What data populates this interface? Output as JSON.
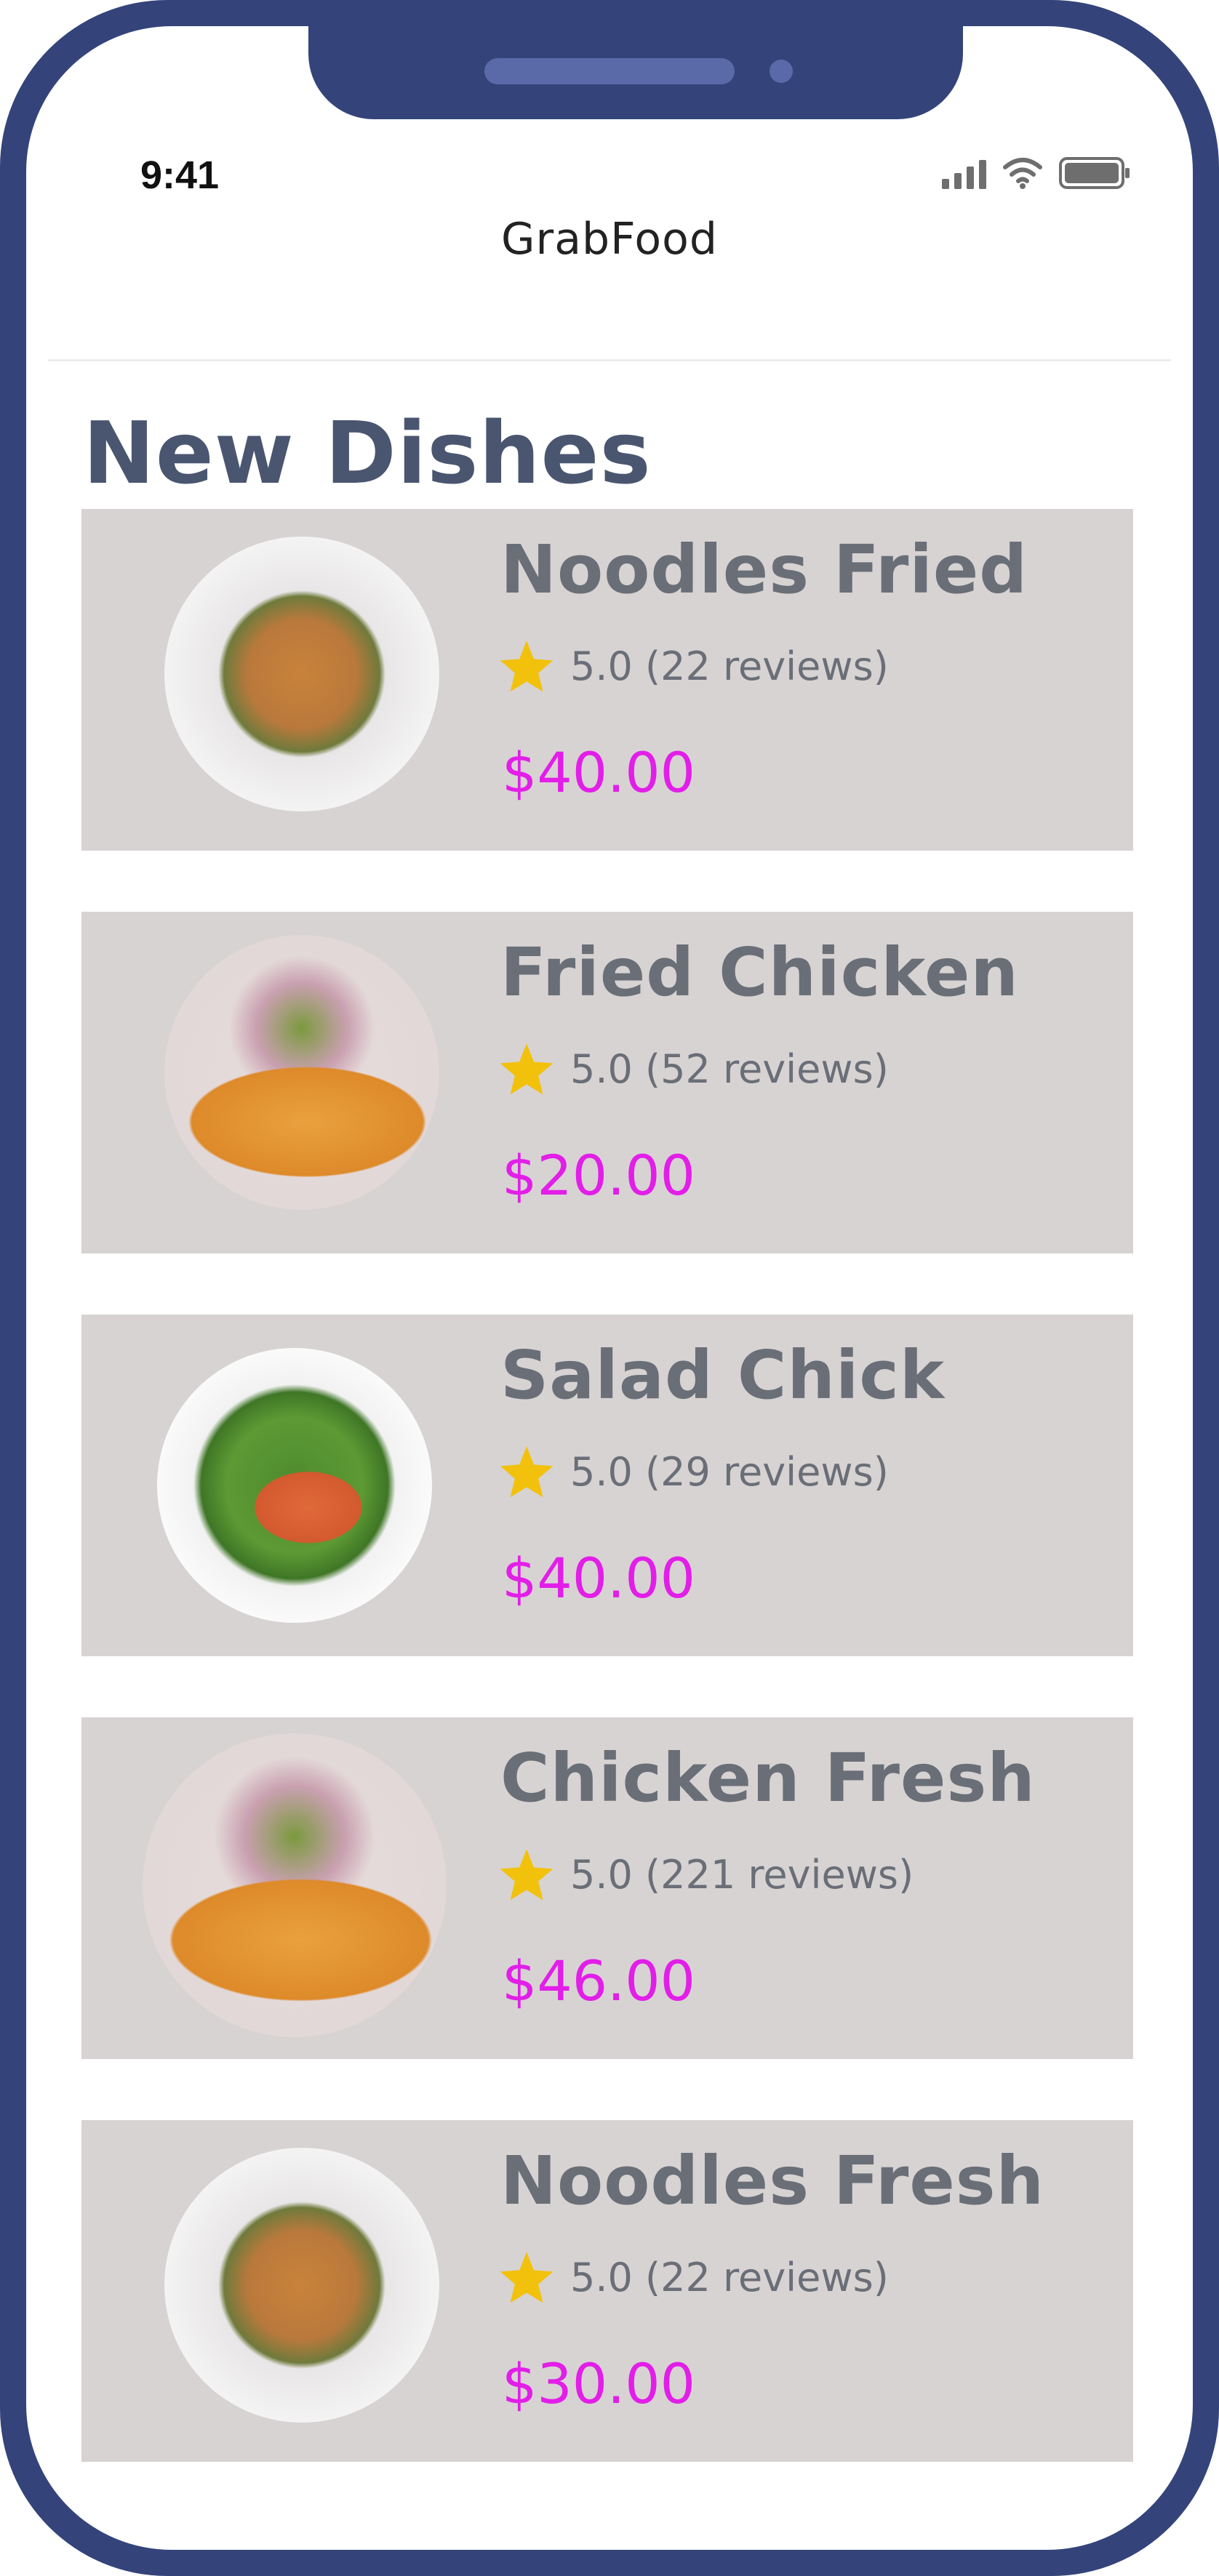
{
  "status_bar": {
    "time": "9:41",
    "signal_icon": "cellular-signal-icon",
    "wifi_icon": "wifi-icon",
    "battery_icon": "battery-icon"
  },
  "app": {
    "title": "GrabFood"
  },
  "section": {
    "title": "New Dishes"
  },
  "dishes": [
    {
      "name": "Noodles Fried",
      "rating": "5.0 (22 reviews)",
      "price": "$40.00",
      "image_icon": "noodles-plate-image"
    },
    {
      "name": "Fried Chicken",
      "rating": "5.0 (52 reviews)",
      "price": "$20.00",
      "image_icon": "omelette-plate-image"
    },
    {
      "name": "Salad Chick",
      "rating": "5.0 (29 reviews)",
      "price": "$40.00",
      "image_icon": "salad-plate-image"
    },
    {
      "name": "Chicken Fresh",
      "rating": "5.0 (221 reviews)",
      "price": "$46.00",
      "image_icon": "omelette-plate-image"
    },
    {
      "name": "Noodles Fresh",
      "rating": "5.0 (22 reviews)",
      "price": "$30.00",
      "image_icon": "noodles-plate-image"
    }
  ],
  "colors": {
    "frame": "#34447a",
    "card_background": "#d7d3d3",
    "dish_name": "#6a6e77",
    "price": "#e21ee8",
    "star": "#f2c10c",
    "section_title": "#4a5670"
  }
}
